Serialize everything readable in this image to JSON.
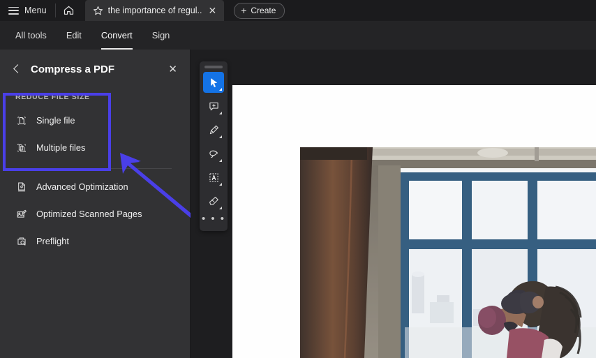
{
  "titlebar": {
    "menu_label": "Menu",
    "menu_icon": "hamburger-icon",
    "home_icon": "home-icon",
    "tab": {
      "star_icon": "star-icon",
      "title": "the importance of regul..",
      "close_icon": "close-icon"
    },
    "create_label": "Create",
    "create_icon": "plus-icon"
  },
  "menubar": {
    "tabs": [
      {
        "label": "All tools",
        "active": false
      },
      {
        "label": "Edit",
        "active": false
      },
      {
        "label": "Convert",
        "active": true
      },
      {
        "label": "Sign",
        "active": false
      }
    ]
  },
  "sidebar": {
    "back_icon": "chevron-left-icon",
    "title": "Compress a PDF",
    "close_icon": "close-icon",
    "group_label": "REDUCE FILE SIZE",
    "highlight_color": "#4a3fe8",
    "items": [
      {
        "label": "Single file",
        "icon": "single-file-icon"
      },
      {
        "label": "Multiple files",
        "icon": "multiple-files-icon"
      }
    ],
    "more_items": [
      {
        "label": "Advanced Optimization",
        "icon": "advanced-optimization-icon"
      },
      {
        "label": "Optimized Scanned Pages",
        "icon": "optimized-scanned-pages-icon"
      },
      {
        "label": "Preflight",
        "icon": "preflight-icon"
      }
    ]
  },
  "quick_toolbar": {
    "grip_icon": "drag-handle-icon",
    "accent_color": "#1473e6",
    "tools": [
      {
        "name": "select-tool",
        "icon": "cursor-arrow-icon",
        "active": true
      },
      {
        "name": "comment-tool",
        "icon": "add-comment-icon",
        "active": false
      },
      {
        "name": "highlight-tool",
        "icon": "highlighter-icon",
        "active": false
      },
      {
        "name": "draw-tool",
        "icon": "lasso-icon",
        "active": false
      },
      {
        "name": "text-select-tool",
        "icon": "text-box-icon",
        "active": false
      },
      {
        "name": "erase-tool",
        "icon": "eraser-icon",
        "active": false
      }
    ],
    "more_label": "• • •"
  },
  "document": {
    "photo_description": "boxer in mask punching a heavy bag beside a tall window"
  }
}
